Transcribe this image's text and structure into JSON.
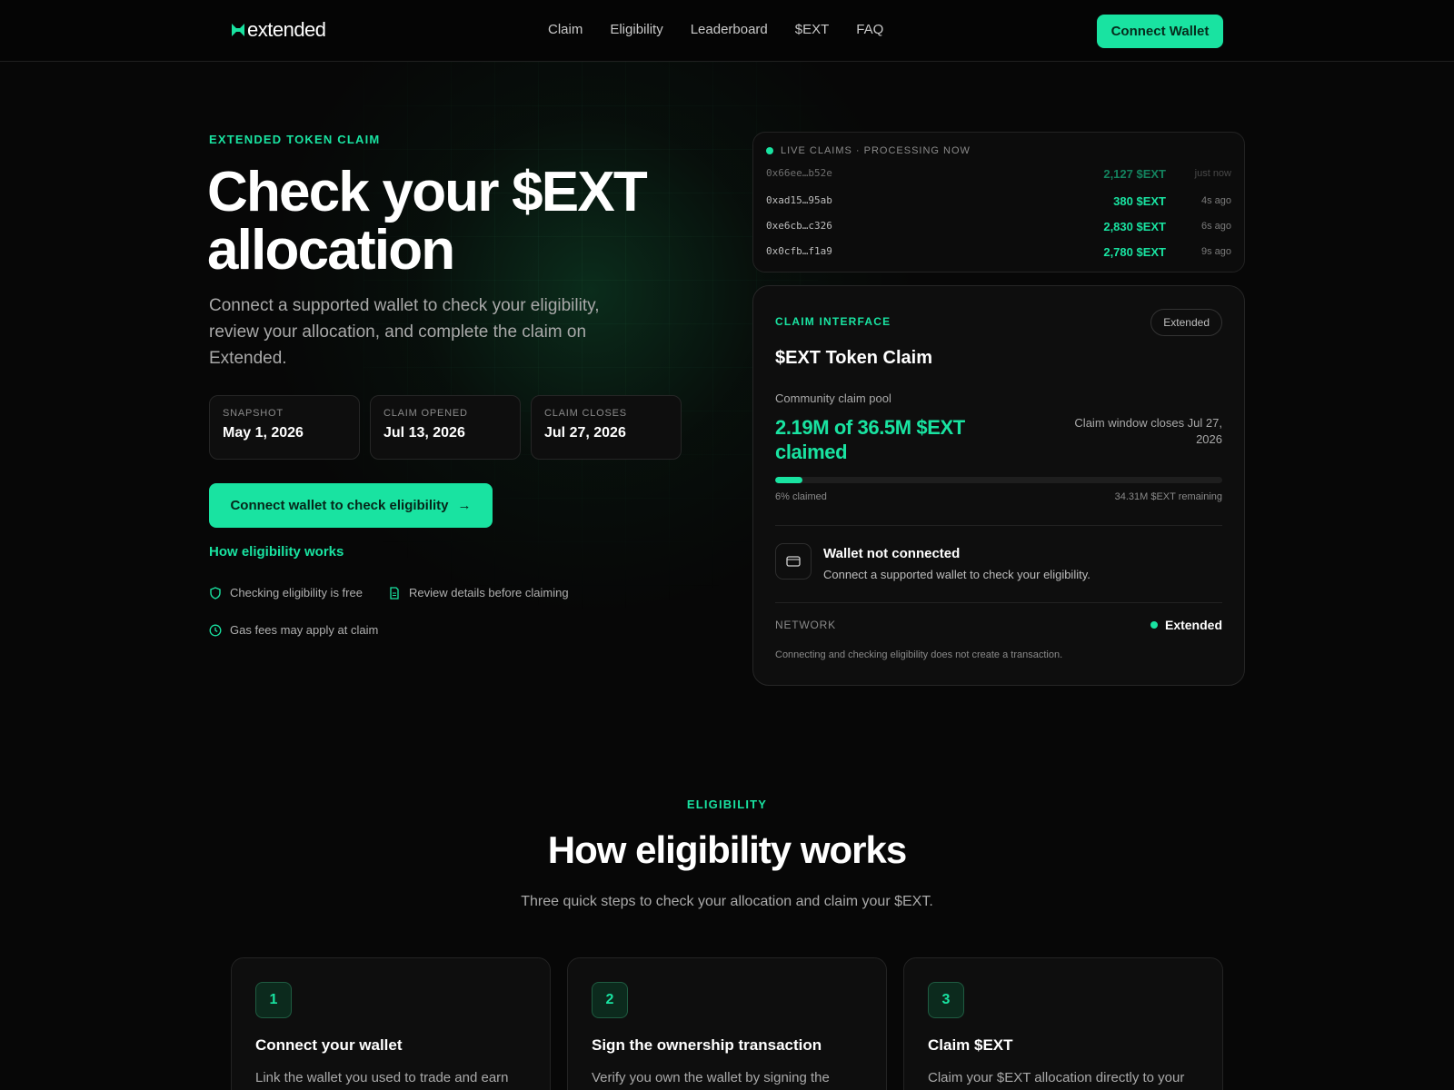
{
  "nav": {
    "logo_text": "extended",
    "links": [
      "Claim",
      "Eligibility",
      "Leaderboard",
      "$EXT",
      "FAQ"
    ],
    "connect_label": "Connect Wallet"
  },
  "hero": {
    "eyebrow": "EXTENDED TOKEN CLAIM",
    "title": "Check your $EXT allocation",
    "subtitle": "Connect a supported wallet to check your eligibility, review your allocation, and complete the claim on Extended.",
    "dates": [
      {
        "label": "SNAPSHOT",
        "value": "May 1, 2026"
      },
      {
        "label": "CLAIM OPENED",
        "value": "Jul 13, 2026"
      },
      {
        "label": "CLAIM CLOSES",
        "value": "Jul 27, 2026"
      }
    ],
    "cta_label": "Connect wallet to check eligibility",
    "cta_arrow": "→",
    "how_link": "How eligibility works",
    "features": [
      {
        "icon": "shield-icon",
        "text": "Checking eligibility is free"
      },
      {
        "icon": "document-icon",
        "text": "Review details before claiming"
      },
      {
        "icon": "clock-icon",
        "text": "Gas fees may apply at claim"
      }
    ]
  },
  "live": {
    "header": "LIVE CLAIMS · PROCESSING NOW",
    "rows": [
      {
        "address": "0x66ee…b52e",
        "amount": "2,127 $EXT",
        "time": "just now"
      },
      {
        "address": "0xad15…95ab",
        "amount": "380 $EXT",
        "time": "4s ago"
      },
      {
        "address": "0xe6cb…c326",
        "amount": "2,830 $EXT",
        "time": "6s ago"
      },
      {
        "address": "0x0cfb…f1a9",
        "amount": "2,780 $EXT",
        "time": "9s ago"
      }
    ]
  },
  "claim": {
    "eyebrow": "CLAIM INTERFACE",
    "pill": "Extended",
    "title": "$EXT Token Claim",
    "pool_label": "Community claim pool",
    "pool_amount": "2.19M of 36.5M $EXT claimed",
    "pool_close": "Claim window closes Jul 27, 2026",
    "progress_fraction": 0.06,
    "progress_left": "6% claimed",
    "progress_right": "34.31M $EXT remaining",
    "wallet_title": "Wallet not connected",
    "wallet_sub": "Connect a supported wallet to check your eligibility.",
    "network_label": "NETWORK",
    "network_value": "Extended",
    "note": "Connecting and checking eligibility does not create a transaction."
  },
  "eligibility": {
    "eyebrow": "ELIGIBILITY",
    "title": "How eligibility works",
    "subtitle": "Three quick steps to check your allocation and claim your $EXT.",
    "steps": [
      {
        "num": "1",
        "title": "Connect your wallet",
        "desc": "Link the wallet you used to trade and earn points on Extended. Your eligibility is"
      },
      {
        "num": "2",
        "title": "Sign the ownership transaction",
        "desc": "Verify you own the wallet by signing the ownership transaction. No tokens are"
      },
      {
        "num": "3",
        "title": "Claim $EXT",
        "desc": "Claim your $EXT allocation directly to your connected wallet."
      }
    ]
  },
  "colors": {
    "accent": "#19e3a1",
    "background": "#070707",
    "card": "#0e0e0e"
  }
}
